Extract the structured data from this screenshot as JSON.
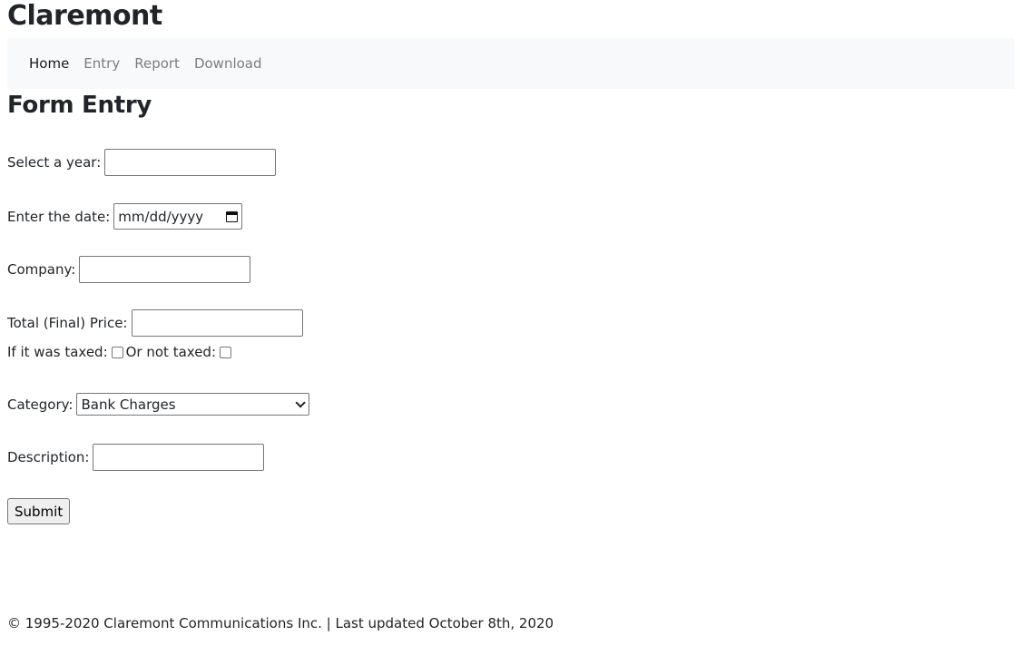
{
  "site": {
    "title": "Claremont"
  },
  "nav": {
    "items": [
      {
        "label": "Home"
      },
      {
        "label": "Entry"
      },
      {
        "label": "Report"
      },
      {
        "label": "Download"
      }
    ]
  },
  "form": {
    "title": "Form Entry",
    "year_label": "Select a year:",
    "year_value": "",
    "date_label": "Enter the date:",
    "date_placeholder": "mm/dd/yyyy",
    "company_label": "Company:",
    "company_value": "",
    "price_label": "Total (Final) Price:",
    "price_value": "",
    "taxed_label": "If it was taxed:",
    "not_taxed_label": "Or not taxed:",
    "category_label": "Category:",
    "category_selected": "Bank Charges",
    "description_label": "Description:",
    "description_value": "",
    "submit_label": "Submit"
  },
  "footer": {
    "text": "© 1995-2020 Claremont Communications Inc. | Last updated October 8th, 2020"
  }
}
